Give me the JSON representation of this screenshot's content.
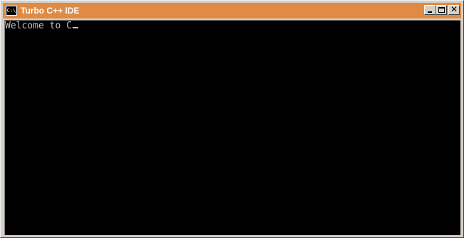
{
  "window": {
    "title": "Turbo C++ IDE",
    "icon": "console-icon",
    "icon_text": "C:\\"
  },
  "titlebar_buttons": {
    "minimize": "minimize-icon",
    "maximize": "maximize-icon",
    "close": "close-icon",
    "close_glyph": "✕"
  },
  "console": {
    "output": "Welcome to C"
  },
  "colors": {
    "titlebar": "#e08a44",
    "console_bg": "#000000",
    "console_text": "#c0c0c0"
  }
}
